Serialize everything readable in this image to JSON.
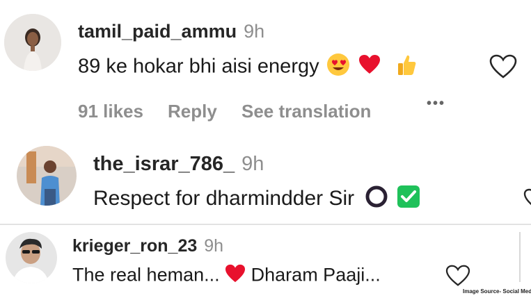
{
  "comments": [
    {
      "username": "tamil_paid_ammu",
      "time": "9h",
      "text": "89 ke hokar bhi aisi energy",
      "emojis": [
        "smiling-face-with-heart-eyes",
        "red-heart",
        "thumbs-up"
      ],
      "likes": "91 likes",
      "reply": "Reply",
      "see_translation": "See translation",
      "more": "•••"
    },
    {
      "username": "the_israr_786_",
      "time": "9h",
      "text": "Respect for dharmindder Sir",
      "emojis": [
        "hollow-red-circle",
        "check-mark-button"
      ]
    },
    {
      "username": "krieger_ron_23",
      "time": "9h",
      "text_part1": "The real heman...",
      "text_part2": "Dharam Paaji...",
      "emojis": [
        "red-heart"
      ]
    }
  ],
  "watermark": "Image Source- Social Media",
  "colors": {
    "heart_red": "#e8112d",
    "emoji_yellow": "#ffc83d",
    "check_green": "#1fc15a",
    "meta_gray": "#8e8e8e"
  }
}
